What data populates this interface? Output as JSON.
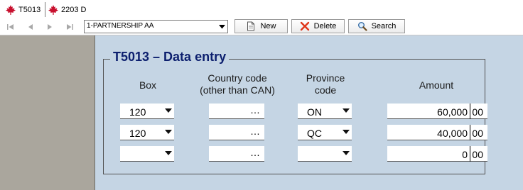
{
  "tabs": [
    {
      "label": "T5013"
    },
    {
      "label": "2203 D"
    }
  ],
  "toolbar": {
    "nav_icons": [
      "first-icon",
      "previous-icon",
      "next-icon",
      "last-icon"
    ],
    "selector_value": "1-PARTNERSHIP AA",
    "new_label": "New",
    "delete_label": "Delete",
    "search_label": "Search"
  },
  "form": {
    "title": "T5013 – Data entry",
    "headers": {
      "box": "Box",
      "country_line1": "Country code",
      "country_line2": "(other than CAN)",
      "province_line1": "Province",
      "province_line2": "code",
      "amount": "Amount"
    },
    "rows": [
      {
        "box": "120",
        "country": "",
        "province": "ON",
        "amount": "60,000",
        "cents": "00"
      },
      {
        "box": "120",
        "country": "",
        "province": "QC",
        "amount": "40,000",
        "cents": "00"
      },
      {
        "box": "",
        "country": "",
        "province": "",
        "amount": "0",
        "cents": "00"
      }
    ],
    "ellipsis": "…"
  },
  "colors": {
    "form_background": "#c5d5e4",
    "title_color": "#0c1f6e",
    "left_pane": "#aaa69d",
    "maple_leaf": "#c8102e"
  }
}
